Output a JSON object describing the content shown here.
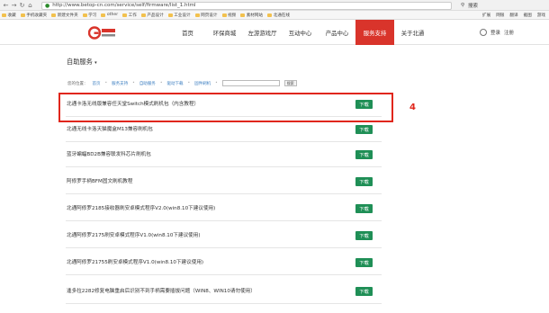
{
  "browser": {
    "url": "http://www.betop-cn.com/service/self/firmware/list_1.html",
    "search_label": "搜索",
    "bookmarks": [
      "收藏",
      "手机收藏夹",
      "新建文件夹",
      "学习",
      "other",
      "工作",
      "产品设计",
      "工业设计",
      "网页设计",
      "视频",
      "素材网站",
      "北通在线"
    ],
    "bookmarks_right": [
      "扩展",
      "网银",
      "翻译",
      "截图",
      "游戏"
    ]
  },
  "header": {
    "nav": [
      "首页",
      "环保商城",
      "左游游戏厅",
      "互动中心",
      "产品中心",
      "服务支持",
      "关于北通"
    ],
    "active_index": 5,
    "user_login": "登录",
    "user_register": "注册"
  },
  "section": {
    "title": "自助服务"
  },
  "breadcrumb": {
    "prefix": "您的位置：",
    "items": [
      "首页",
      "服务支持",
      "自助服务",
      "驱动下载",
      "固件刷机"
    ],
    "search_button": "搜索"
  },
  "rows": [
    {
      "title": "北通卡洛无线版兼容任天堂Switch模式刷机包（内含教程）",
      "button": "下载"
    },
    {
      "title": "北通无线卡洛天猫魔盒M13兼容刷机包",
      "button": "下载"
    },
    {
      "title": "蓝牙蝙蝠BD2B兼容联发科芯片刷机包",
      "button": "下载"
    },
    {
      "title": "阿修罗手柄BFM固文刷机教程",
      "button": "下载"
    },
    {
      "title": "北通阿修罗2185接收器刷安卓模式程序V2.0(win8.10下建议使用)",
      "button": "下载"
    },
    {
      "title": "北通阿修罗2175刷安卓模式程序V1.0(win8.10下建议使用)",
      "button": "下载"
    },
    {
      "title": "北通阿修罗21755刷安卓模式程序V1.0(win8.10下建议使用)",
      "button": "下载"
    },
    {
      "title": "逢多拉2282修复电脑重启后识别不到手柄需要插拔问题（WIN8、WIN10请勿使用）",
      "button": "下载"
    }
  ],
  "annotation": {
    "number": "4"
  },
  "colors": {
    "active_nav": "#d9342b",
    "download": "#1f8f56",
    "highlight": "#e0261b"
  }
}
